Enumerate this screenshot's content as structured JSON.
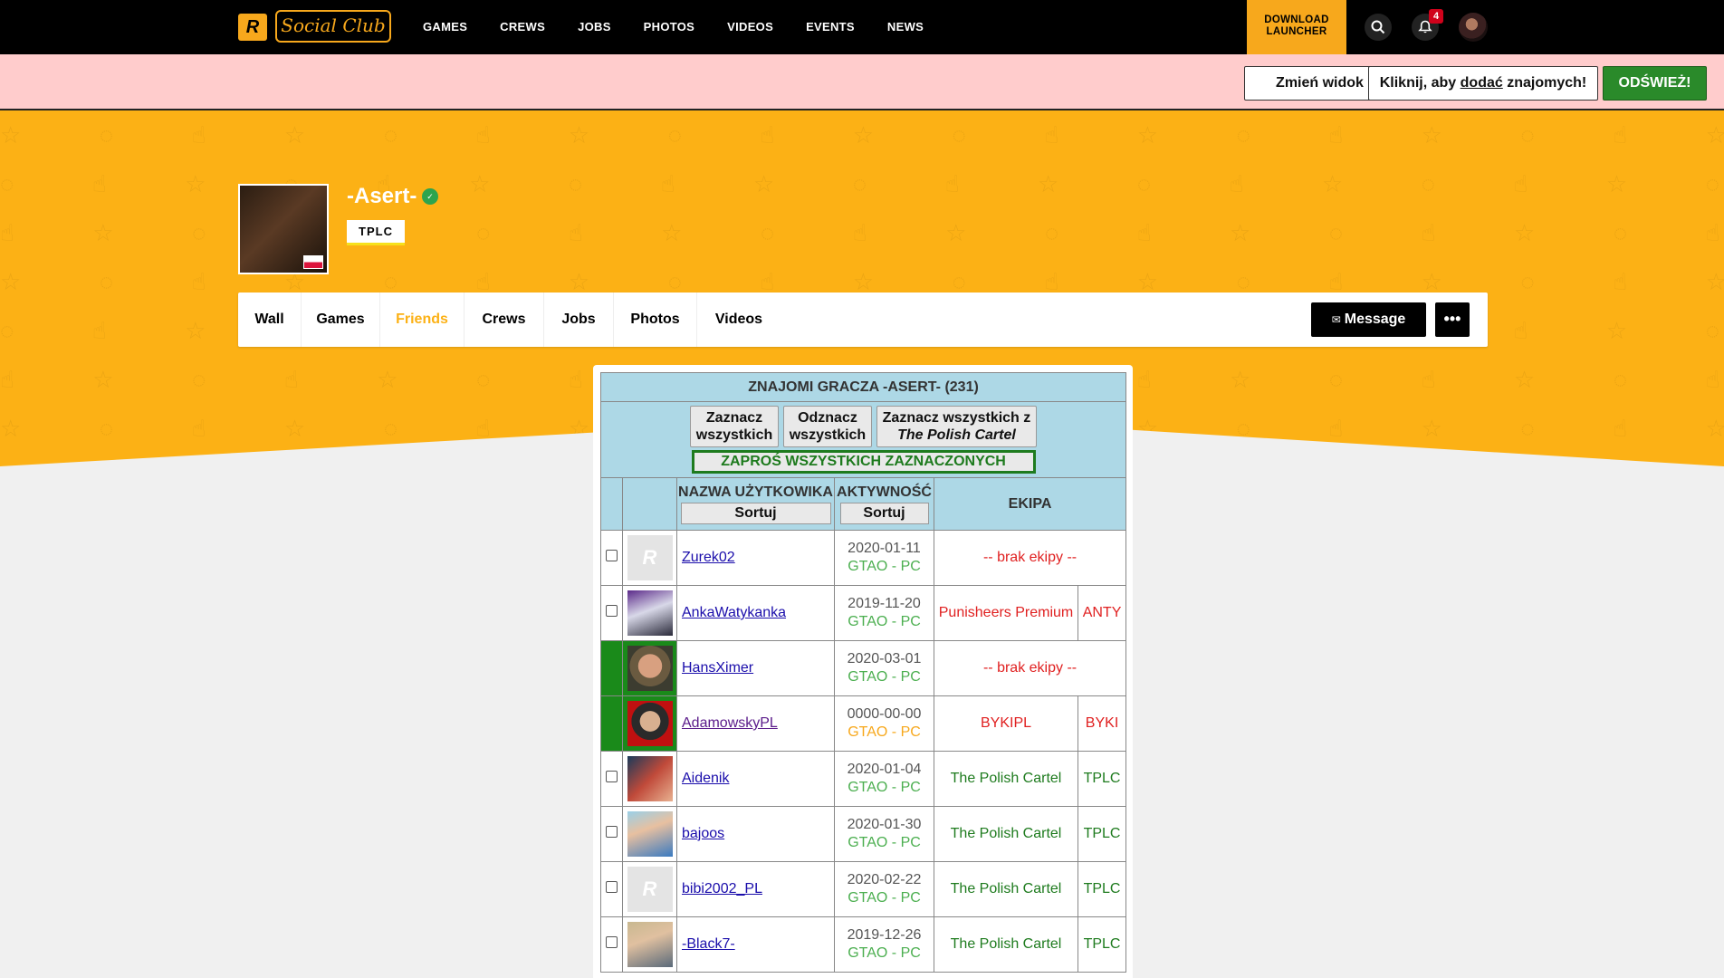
{
  "nav": {
    "logo_letter": "R",
    "logo_text": "Social Club",
    "links": [
      "GAMES",
      "CREWS",
      "JOBS",
      "PHOTOS",
      "VIDEOS",
      "EVENTS",
      "NEWS"
    ],
    "download_line1": "DOWNLOAD",
    "download_line2": "LAUNCHER",
    "notif_count": "4"
  },
  "toolbar": {
    "change_view": "Zmień widok",
    "add_friends_pre": "Kliknij, aby ",
    "add_friends_link": "dodać",
    "add_friends_post": " znajomych!",
    "refresh": "ODŚWIEŻ!"
  },
  "profile": {
    "name": "-Asert-",
    "crew_tag": "TPLC",
    "tabs": [
      "Wall",
      "Games",
      "Friends",
      "Crews",
      "Jobs",
      "Photos",
      "Videos"
    ],
    "active_tab": "Friends",
    "message_label": "Message",
    "more_label": "•••"
  },
  "friends": {
    "title": "ZNAJOMI GRACZA -ASERT- (231)",
    "select_all_1": "Zaznacz",
    "select_all_2": "wszystkich",
    "deselect_all_1": "Odznacz",
    "deselect_all_2": "wszystkich",
    "select_crew_1": "Zaznacz wszystkich z",
    "select_crew_2": "The Polish Cartel",
    "invite_all": "ZAPROŚ WSZYSTKICH ZAZNACZONYCH",
    "col_username": "NAZWA UŻYTKOWIKA",
    "col_activity": "AKTYWNOŚĆ",
    "col_crew": "EKIPA",
    "sort_label": "Sortuj",
    "rows": [
      {
        "name": "Zurek02",
        "date": "2020-01-11",
        "platform": "GTAO - PC",
        "crew": "-- brak ekipy --",
        "tag": ""
      },
      {
        "name": "AnkaWatykanka",
        "date": "2019-11-20",
        "platform": "GTAO - PC",
        "crew": "Punisheers Premium",
        "tag": "ANTY"
      },
      {
        "name": "HansXimer",
        "date": "2020-03-01",
        "platform": "GTAO - PC",
        "crew": "-- brak ekipy --",
        "tag": ""
      },
      {
        "name": "AdamowskyPL",
        "date": "0000-00-00",
        "platform": "GTAO - PC",
        "crew": "BYKIPL",
        "tag": "BYKI"
      },
      {
        "name": "Aidenik",
        "date": "2020-01-04",
        "platform": "GTAO - PC",
        "crew": "The Polish Cartel",
        "tag": "TPLC"
      },
      {
        "name": "bajoos",
        "date": "2020-01-30",
        "platform": "GTAO - PC",
        "crew": "The Polish Cartel",
        "tag": "TPLC"
      },
      {
        "name": "bibi2002_PL",
        "date": "2020-02-22",
        "platform": "GTAO - PC",
        "crew": "The Polish Cartel",
        "tag": "TPLC"
      },
      {
        "name": "-Black7-",
        "date": "2019-12-26",
        "platform": "GTAO - PC",
        "crew": "The Polish Cartel",
        "tag": "TPLC"
      }
    ]
  },
  "colors": {
    "brand_orange": "#fcb115",
    "pink_bar": "#ffcccc",
    "table_header": "#add8e6",
    "refresh_green": "#2a8a2a"
  }
}
